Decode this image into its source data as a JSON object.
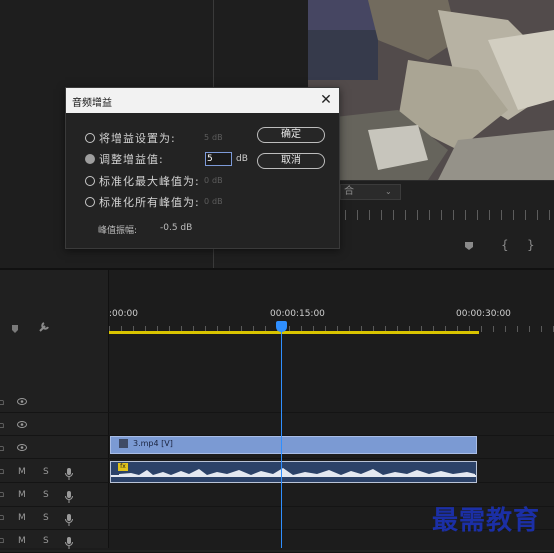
{
  "dialog": {
    "title": "音频增益",
    "close_glyph": "✕",
    "options": [
      {
        "label": "将增益设置为:",
        "value": "5",
        "unit": "dB",
        "selected": false
      },
      {
        "label": "调整增益值:",
        "value": "5",
        "unit": "dB",
        "selected": true
      },
      {
        "label": "标准化最大峰值为:",
        "value": "0",
        "unit": "dB",
        "selected": false
      },
      {
        "label": "标准化所有峰值为:",
        "value": "0",
        "unit": "dB",
        "selected": false
      }
    ],
    "peak_label": "峰值振幅:",
    "peak_value": "-0.5 dB",
    "ok_label": "确定",
    "cancel_label": "取消"
  },
  "program_monitor": {
    "dropdown_fragment": "合",
    "control_icons": [
      "marker-icon",
      "in-point-icon",
      "out-point-icon"
    ]
  },
  "timeline": {
    "time_labels": [
      ":00:00",
      "00:00:15:00",
      "00:00:30:00"
    ],
    "video_clip_label": "3.mp4 [V]",
    "fx_badge": "fx",
    "track_letters": {
      "mute": "M",
      "solo": "S"
    }
  },
  "watermark": "最需教育",
  "colors": {
    "playhead": "#2f8fff",
    "work_area": "#d9c400",
    "video_clip": "#7b9ad3",
    "audio_clip": "#2c4268"
  }
}
